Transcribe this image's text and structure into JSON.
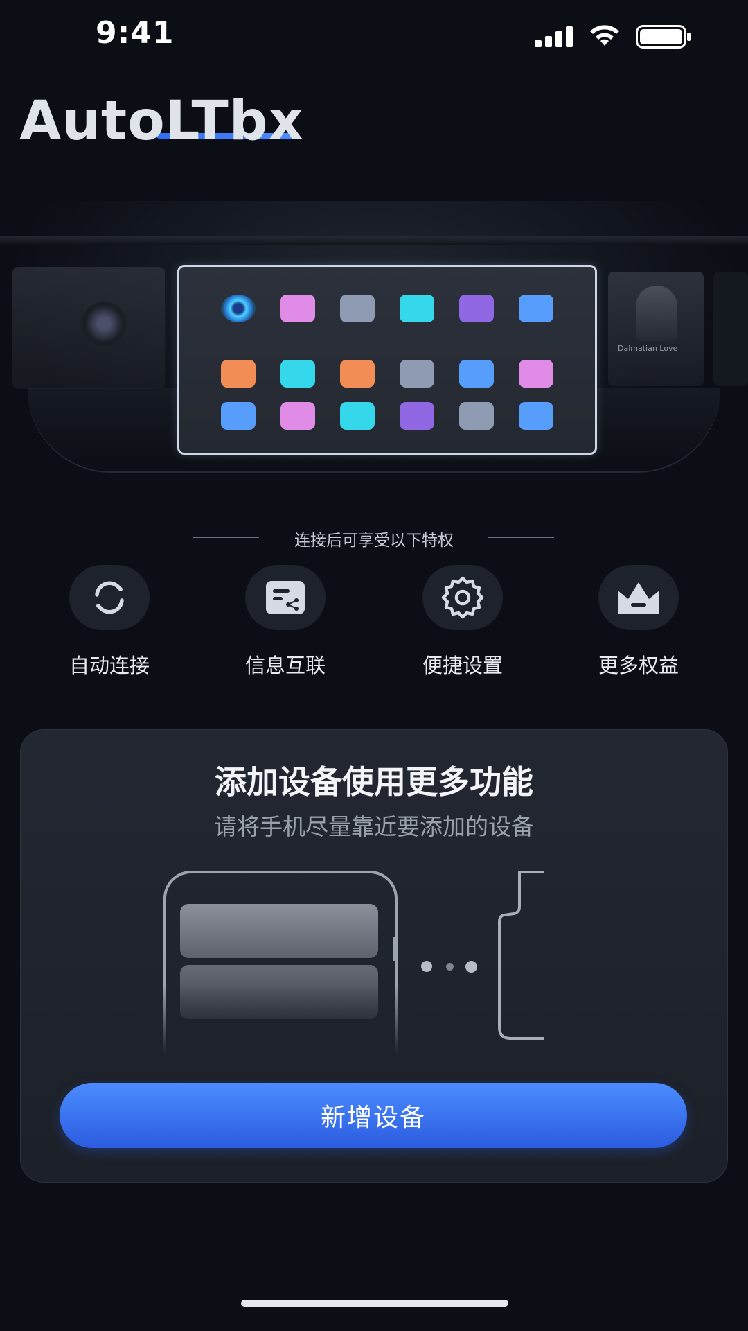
{
  "status_bar": {
    "time": "9:41"
  },
  "app": {
    "title": "AutoLTbx"
  },
  "hero": {
    "right_card_title": "Dalmatian Love",
    "app_grid_colors": [
      [
        "#3ab8ff",
        "#e08ce6",
        "#8e9bb3",
        "#34d8ea",
        "#9068e3",
        "#579dfb"
      ],
      [
        "#f28d55",
        "#34d8ea",
        "#f28d55",
        "#8e9bb3",
        "#579dfb",
        "#e08ce6"
      ],
      [
        "#579dfb",
        "#e08ce6",
        "#34d8ea",
        "#9068e3",
        "#8e9bb3",
        "#579dfb"
      ]
    ]
  },
  "privileges": {
    "caption": "连接后可享受以下特权",
    "features": [
      {
        "icon": "sync-icon",
        "label": "自动连接"
      },
      {
        "icon": "message-share-icon",
        "label": "信息互联"
      },
      {
        "icon": "gear-icon",
        "label": "便捷设置"
      },
      {
        "icon": "crown-icon",
        "label": "更多权益"
      }
    ]
  },
  "add_device": {
    "title": "添加设备使用更多功能",
    "subtitle": "请将手机尽量靠近要添加的设备",
    "button_label": "新增设备"
  },
  "colors": {
    "accent": "#3d7bf5",
    "background": "#0b0e14",
    "card": "#1f232c"
  }
}
